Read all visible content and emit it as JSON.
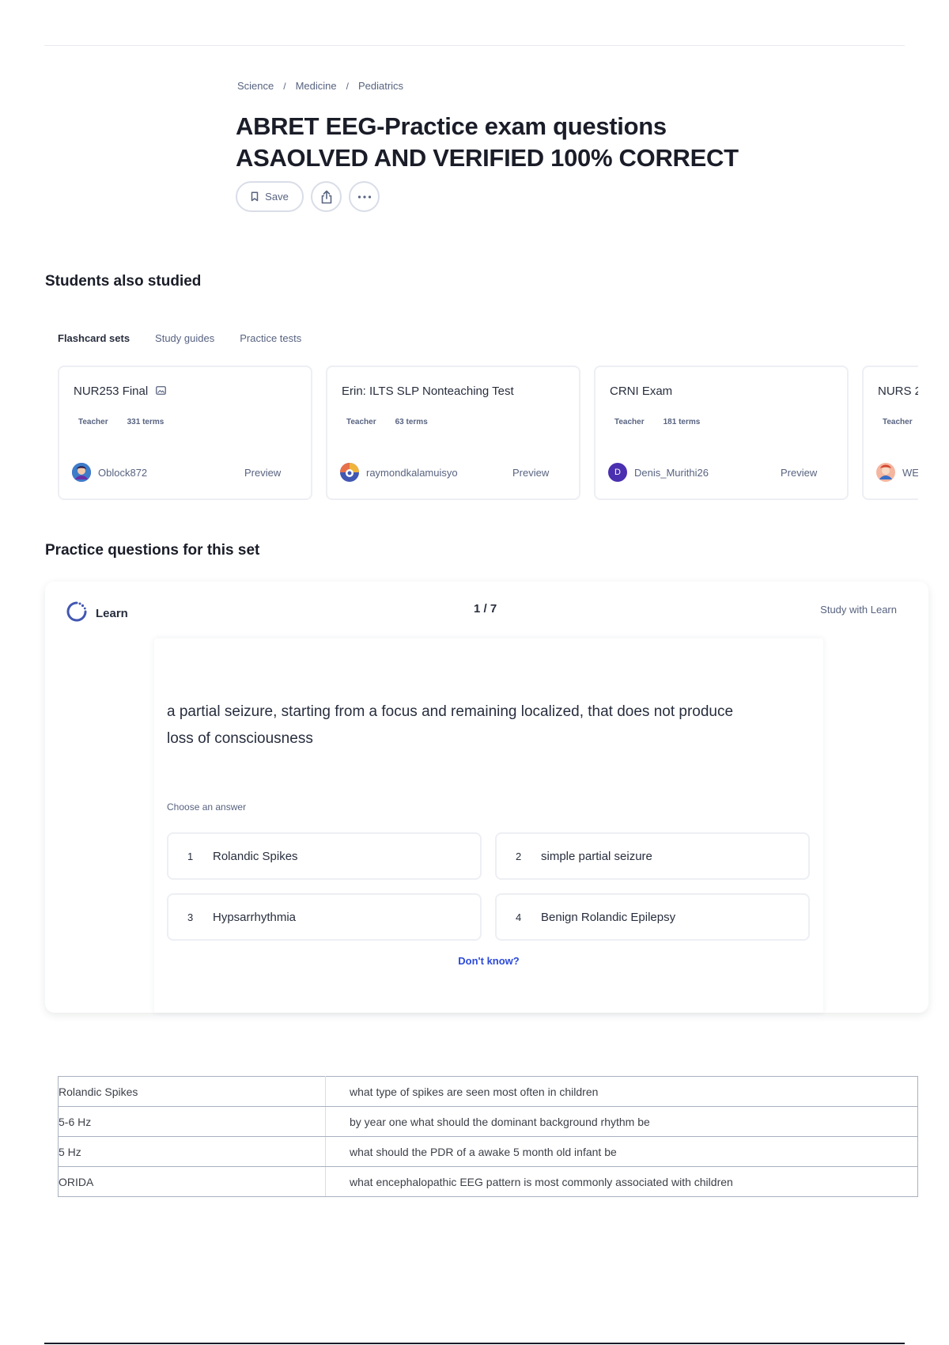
{
  "breadcrumb": [
    "Science",
    "Medicine",
    "Pediatrics"
  ],
  "breadcrumb_sep": "/",
  "title_line1": "ABRET EEG-Practice exam questions",
  "title_line2": "ASAOLVED AND VERIFIED 100% CORRECT",
  "actions": {
    "save": "Save",
    "share_icon": "share-icon",
    "more_icon": "more-icon"
  },
  "students_also_studied": {
    "heading": "Students also studied",
    "tabs": [
      "Flashcard sets",
      "Study guides",
      "Practice tests"
    ],
    "cards": [
      {
        "title": "NUR253 Final",
        "has_image_icon": true,
        "role": "Teacher",
        "terms": "331 terms",
        "user": "Oblock872",
        "avatar_color": "#5b3ea6",
        "avatar_letter": "",
        "preview": "Preview"
      },
      {
        "title": "Erin: ILTS SLP Nonteaching Test",
        "has_image_icon": false,
        "role": "Teacher",
        "terms": "63 terms",
        "user": "raymondkalamuisyo",
        "avatar_color": "#4257b2",
        "avatar_letter": "",
        "preview": "Preview"
      },
      {
        "title": "CRNI Exam",
        "has_image_icon": false,
        "role": "Teacher",
        "terms": "181 terms",
        "user": "Denis_Murithi26",
        "avatar_color": "#4a2fb0",
        "avatar_letter": "D",
        "preview": "Preview"
      },
      {
        "title": "NURS 2",
        "has_image_icon": false,
        "role": "Teacher",
        "terms": "",
        "user": "WE",
        "avatar_color": "#e8704a",
        "avatar_letter": "",
        "preview": ""
      }
    ]
  },
  "practice": {
    "heading": "Practice questions for this set",
    "mode": "Learn",
    "progress": "1 / 7",
    "study_link": "Study with Learn",
    "question": "a partial seizure, starting from a focus and remaining localized, that does not produce loss of consciousness",
    "choose_label": "Choose an answer",
    "answers": [
      {
        "num": "1",
        "text": "Rolandic Spikes"
      },
      {
        "num": "2",
        "text": "simple partial seizure"
      },
      {
        "num": "3",
        "text": "Hypsarrhythmia"
      },
      {
        "num": "4",
        "text": "Benign Rolandic Epilepsy"
      }
    ],
    "dont_know": "Don't know?"
  },
  "terms_table": [
    {
      "term": "Rolandic Spikes",
      "definition": "what type of spikes are seen most often in children"
    },
    {
      "term": "5-6 Hz",
      "definition": "by year one what should the dominant background rhythm be"
    },
    {
      "term": "5 Hz",
      "definition": "what should the PDR of a awake 5 month old infant be"
    },
    {
      "term": "ORIDA",
      "definition": "what encephalopathic EEG pattern is most commonly associated with children"
    }
  ]
}
